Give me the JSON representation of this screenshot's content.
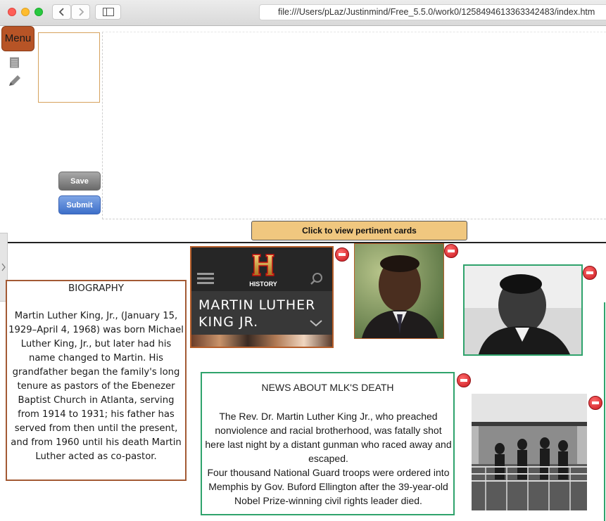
{
  "browser": {
    "url": "file:///Users/pLaz/Justinmind/Free_5.5.0/work0/1258494613363342483/index.htm",
    "controls": {
      "back_icon": "chevron-left-icon",
      "forward_icon": "chevron-right-icon",
      "sidebar_icon": "sidebar-icon"
    },
    "traffic_lights": [
      "#fe5f57",
      "#febc2e",
      "#28c840"
    ]
  },
  "toolbar": {
    "menu_label": "Menu",
    "tool_icons": [
      "document-icon",
      "pencil-icon"
    ]
  },
  "form": {
    "save_label": "Save",
    "submit_label": "Submit"
  },
  "view_cards_label": "Click to view pertinent cards",
  "cards": {
    "biography": {
      "title": "BIOGRAPHY",
      "text": "Martin Luther King, Jr., (January 15, 1929–April 4, 1968) was born Michael Luther King, Jr., but later had his name changed to Martin. His grandfather began the family's long tenure as pastors of the Ebenezer Baptist Church in Atlanta, serving from 1914 to 1931; his father has served from then until the present, and from 1960 until his death Martin Luther acted as co-pastor."
    },
    "history": {
      "logo_text": "HISTORY",
      "headline": "MARTIN LUTHER KING JR."
    },
    "news": {
      "title": "NEWS ABOUT MLK'S DEATH",
      "paragraph_1": "The Rev. Dr. Martin Luther King Jr., who preached nonviolence and racial brotherhood, was fatally shot here last night by a distant gunman who raced away and escaped.",
      "paragraph_2": "Four thousand National Guard troops were ordered into Memphis by Gov. Buford Ellington after the 39-year-old Nobel Prize-winning civil rights leader died."
    }
  },
  "colors": {
    "menu_button": "#b75426",
    "view_cards_button": "#f0c77f",
    "card_border_brown": "#a35a34",
    "card_border_green": "#2fa36c",
    "delete_button": "#c9161d"
  }
}
